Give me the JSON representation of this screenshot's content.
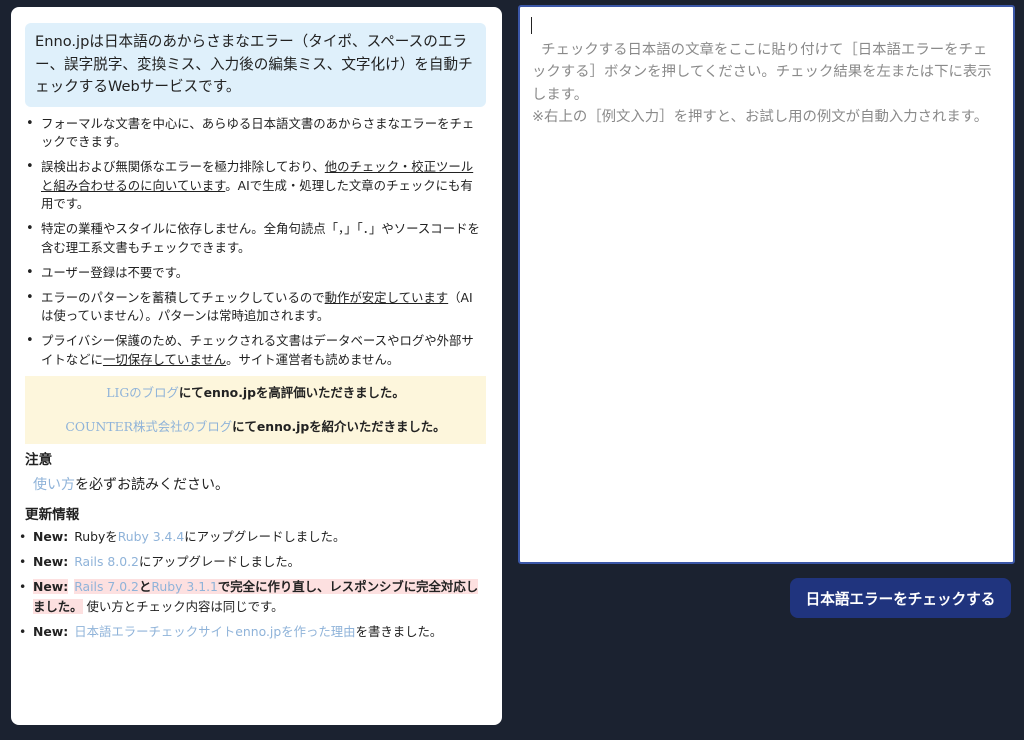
{
  "intro": {
    "text": "Enno.jpは日本語のあからさまなエラー（タイポ、スペースのエラー、誤字脱字、変換ミス、入力後の編集ミス、文字化け）を自動チェックするWebサービスです。"
  },
  "features": {
    "item1": "フォーマルな文書を中心に、あらゆる日本語文書のあからさまなエラーをチェックできます。",
    "item2_a": "誤検出および無関係なエラーを極力排除しており、",
    "item2_u": "他のチェック・校正ツールと組み合わせるのに向いています",
    "item2_b": "。AIで生成・処理した文章のチェックにも有用です。",
    "item3": "特定の業種やスタイルに依存しません。全角句読点「，」「．」やソースコードを含む理工系文書もチェックできます。",
    "item4": "ユーザー登録は不要です。",
    "item5_a": "エラーのパターンを蓄積してチェックしているので",
    "item5_u": "動作が安定しています",
    "item5_b": "（AIは使っていません）。パターンは常時追加されます。",
    "item6_a": "プライバシー保護のため、チェックされる文書はデータベースやログや外部サイトなどに",
    "item6_u": "一切保存していません",
    "item6_b": "。サイト運営者も読めません。"
  },
  "praise": {
    "line1_link": "LIGのブログ",
    "line1_text": "にてenno.jpを高評価いただきました。",
    "line2_link": "COUNTER株式会社のブログ",
    "line2_text": "にてenno.jpを紹介いただきました。"
  },
  "notice": {
    "title": "注意",
    "link": "使い方",
    "text": "を必ずお読みください。"
  },
  "updates": {
    "title": "更新情報",
    "new_label": "New:",
    "u1_a": "Rubyを",
    "u1_link": "Ruby 3.4.4",
    "u1_b": "にアップグレードしました。",
    "u2_link": "Rails 8.0.2",
    "u2_b": "にアップグレードしました。",
    "u3_link1": "Rails 7.0.2",
    "u3_and": "と",
    "u3_link2": "Ruby 3.1.1",
    "u3_hl": "で完全に作り直し、レスポンシブに完全対応しました。",
    "u3_b": " 使い方とチェック内容は同じです。",
    "u4_link": "日本語エラーチェックサイトenno.jpを作った理由",
    "u4_b": "を書きました。"
  },
  "textarea": {
    "placeholder": "チェックする日本語の文章をここに貼り付けて［日本語エラーをチェックする］ボタンを押してください。チェック結果を左または下に表示します。\n※右上の［例文入力］を押すと、お試し用の例文が自動入力されます。"
  },
  "button": {
    "label": "日本語エラーをチェックする"
  },
  "colors": {
    "background": "#1b2230",
    "intro_bg": "#dff0fb",
    "praise_bg": "#fdf6dc",
    "highlight_bg": "#fde0e0",
    "link": "#8fb3d9",
    "button_bg": "#20347e",
    "textarea_border": "#3b57a8"
  }
}
